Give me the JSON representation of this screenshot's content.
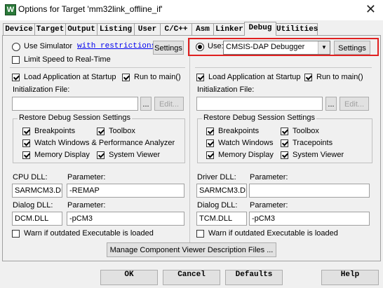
{
  "window": {
    "title": "Options for Target 'mm32link_offline_if'",
    "close_glyph": "✕",
    "icon_letter": "W"
  },
  "tabs": [
    "Device",
    "Target",
    "Output",
    "Listing",
    "User",
    "C/C++",
    "Asm",
    "Linker",
    "Debug",
    "Utilities"
  ],
  "left": {
    "use_simulator": "Use Simulator",
    "restrictions_link": "with restrictions",
    "settings": "Settings",
    "limit_speed": "Limit Speed to Real-Time",
    "load_app": "Load Application at Startup",
    "run_to_main": "Run to main()",
    "init_file": "Initialization File:",
    "browse": "...",
    "edit": "Edit...",
    "restore_group": "Restore Debug Session Settings",
    "breakpoints": "Breakpoints",
    "toolbox": "Toolbox",
    "watch_windows": "Watch Windows & Performance Analyzer",
    "memory_display": "Memory Display",
    "system_viewer": "System Viewer",
    "cpu_dll_label": "CPU DLL:",
    "parameter_label": "Parameter:",
    "cpu_dll": "SARMCM3.DLL",
    "cpu_param": "-REMAP",
    "dialog_dll_label": "Dialog DLL:",
    "dialog_dll": "DCM.DLL",
    "dialog_param": "-pCM3",
    "warn_outdated": "Warn if outdated Executable is loaded"
  },
  "right": {
    "use": "Use:",
    "debugger": "CMSIS-DAP Debugger",
    "settings": "Settings",
    "load_app": "Load Application at Startup",
    "run_to_main": "Run to main()",
    "init_file": "Initialization File:",
    "browse": "...",
    "edit": "Edit...",
    "restore_group": "Restore Debug Session Settings",
    "breakpoints": "Breakpoints",
    "toolbox": "Toolbox",
    "watch_windows": "Watch Windows",
    "tracepoints": "Tracepoints",
    "memory_display": "Memory Display",
    "system_viewer": "System Viewer",
    "driver_dll_label": "Driver DLL:",
    "parameter_label": "Parameter:",
    "driver_dll": "SARMCM3.DLL",
    "driver_param": "",
    "dialog_dll_label": "Dialog DLL:",
    "dialog_dll": "TCM.DLL",
    "dialog_param": "-pCM3",
    "warn_outdated": "Warn if outdated Executable is loaded"
  },
  "manage_button": "Manage Component Viewer Description Files ...",
  "footer": {
    "ok": "OK",
    "cancel": "Cancel",
    "defaults": "Defaults",
    "help": "Help"
  },
  "colors": {
    "highlight_border": "#e02020",
    "link": "#0000ee"
  }
}
